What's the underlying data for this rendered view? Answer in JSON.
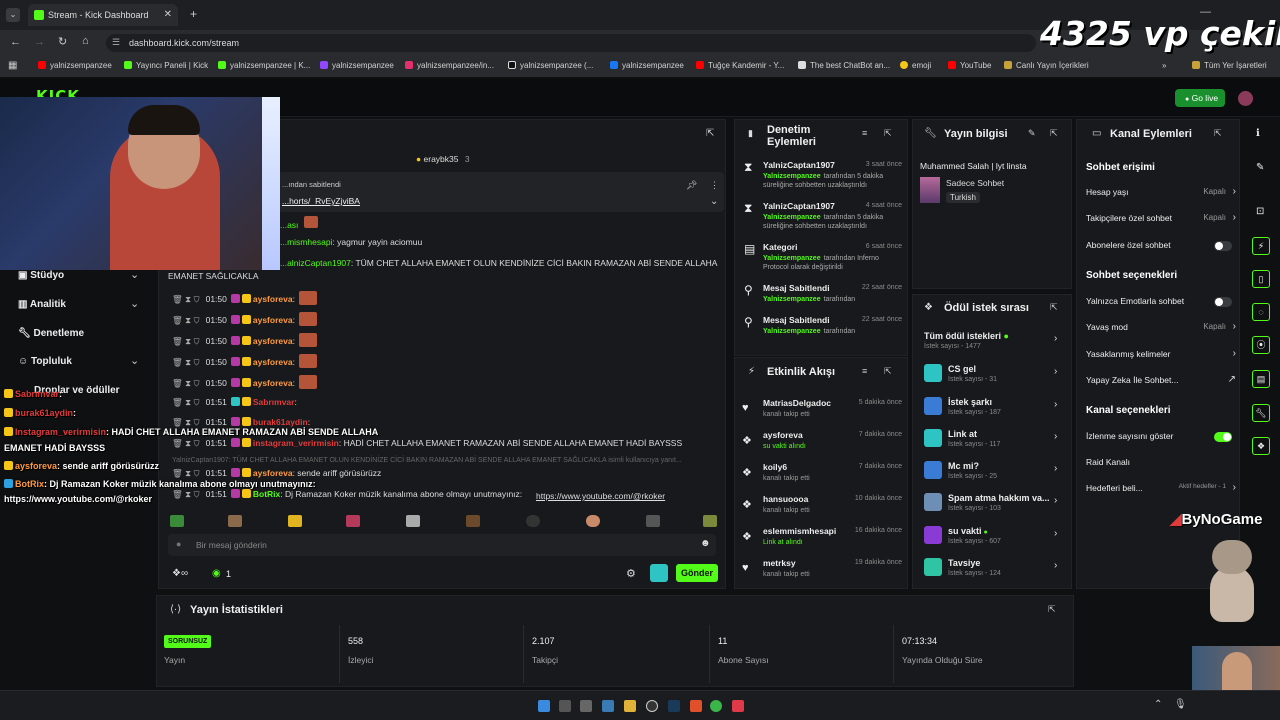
{
  "browser": {
    "tab_title": "Stream - Kick Dashboard",
    "url": "dashboard.kick.com/stream",
    "bookmarks": [
      "yalnizsempanzee",
      "Yayıncı Paneli | Kick",
      "yalnizsempanzee | K...",
      "yalnizsempanzee",
      "yalnizsempanzee/in...",
      "yalnizsempanzee (...",
      "yalnizsempanzee",
      "Tuğçe Kandemir - Y...",
      "The best ChatBot an...",
      "emoji",
      "YouTube",
      "Canlı Yayın İçerikleri",
      "Tüm Yer İşaretleri"
    ]
  },
  "overlay": {
    "giveaway_text": "4325 vp çekiliş",
    "bynogame_text": "ByNoGame",
    "chat_overlay": [
      {
        "user": "Sabrımvar",
        "text": ":",
        "color": "#e23b3b"
      },
      {
        "user": "burak61aydin",
        "text": ":",
        "color": "#e23b3b"
      },
      {
        "user": "Instagram_verirmisin",
        "text": ": HADİ CHET ALLAHA EMANET RAMAZAN ABİ SENDE ALLAHA",
        "color": "#e23b3b"
      },
      {
        "user": "",
        "text": "EMANET HADİ BAYSSS",
        "color": "#ffffff"
      },
      {
        "user": "aysforeva",
        "text": ": sende ariff görüsürüzz",
        "color": "#ff9b3d"
      },
      {
        "user": "BotRix",
        "text": ": Dj Ramazan Koker müzik kanalıma abone olmayı unutmayınız:",
        "color": "#ff9b3d"
      },
      {
        "user": "",
        "text": "https://www.youtube.com/@rkoker",
        "color": "#ffffff"
      }
    ]
  },
  "topnav": {
    "go_live_label": "Go live"
  },
  "sidebar": {
    "items": [
      "Stüdyo",
      "Analitik",
      "Denetleme",
      "Topluluk",
      "Droplar ve ödüller"
    ]
  },
  "chat": {
    "header_user": "eraybk35",
    "header_count": "3",
    "pinned_label": "...ından sabitlendi",
    "pinned_link": "...horts/_RvEyZjviBA",
    "lines": [
      {
        "user": "...ası",
        "text": ""
      },
      {
        "user": "...mismhesapi",
        "text": ": yagmur yayin aciomuu"
      },
      {
        "user": "...alnizCaptan1907",
        "text": ": TÜM CHET ALLAHA EMANET OLUN KENDİNİZE CİCİ BAKIN RAMAZAN ABİ SENDE ALLAHA"
      },
      {
        "user": "",
        "text": "EMANET SAĞLICAKLA"
      }
    ],
    "timed_lines": [
      {
        "time": "01:50",
        "user": "aysforeva",
        "text": ":"
      },
      {
        "time": "01:50",
        "user": "aysforeva",
        "text": ":"
      },
      {
        "time": "01:50",
        "user": "aysforeva",
        "text": ":"
      },
      {
        "time": "01:50",
        "user": "aysforeva",
        "text": ":"
      },
      {
        "time": "01:50",
        "user": "aysforeva",
        "text": ":"
      },
      {
        "time": "01:51",
        "user": "Sabrımvar",
        "text": ":"
      },
      {
        "time": "01:51",
        "user": "burak61aydin",
        "text": ":"
      },
      {
        "time": "01:51",
        "user": "instagram_verirmisin",
        "text": ": HADİ CHET ALLAHA EMANET RAMAZAN ABİ SENDE ALLAHA EMANET HADİ BAYSSS"
      },
      {
        "time": "01:51",
        "user": "aysforeva",
        "text": ": sende ariff görüsürüzz"
      },
      {
        "time": "01:51",
        "user": "BotRix",
        "text": ": Dj Ramazan Koker müzik kanalıma abone olmayı unutmayınız: "
      }
    ],
    "reply_line": "YalnizCaptan1907: TÜM CHET ALLAHA EMANET OLUN KENDİNİZE CİCİ BAKIN RAMAZAN ABİ SENDE ALLAHA EMANET SAĞLICAKLA isimli kullanıcıya yanıt...",
    "botrix_link": "https://www.youtube.com/@rkoker",
    "input_placeholder": "Bir mesaj gönderin",
    "points": "1",
    "send_label": "Gönder"
  },
  "moderation": {
    "title": "Denetim Eylemleri",
    "rows": [
      {
        "icon": "⧗",
        "name": "YalnizCaptan1907",
        "time": "3 saat önce",
        "who": "Yalnizsempanzee",
        "desc": "tarafından 5 dakika süreliğine sohbetten uzaklaştırıldı"
      },
      {
        "icon": "⧗",
        "name": "YalnizCaptan1907",
        "time": "4 saat önce",
        "who": "Yalnizsempanzee",
        "desc": "tarafından 5 dakika süreliğine sohbetten uzaklaştırıldı"
      },
      {
        "icon": "▤",
        "name": "Kategori",
        "time": "6 saat önce",
        "who": "Yalnizsempanzee",
        "desc": "tarafından Inferno Protocol olarak değiştirildi"
      },
      {
        "icon": "⚲",
        "name": "Mesaj Sabitlendi",
        "time": "22 saat önce",
        "who": "Yalnizsempanzee",
        "desc": "tarafından"
      },
      {
        "icon": "⚲",
        "name": "Mesaj Sabitlendi",
        "time": "22 saat önce",
        "who": "Yalnizsempanzee",
        "desc": "tarafından"
      }
    ]
  },
  "activity": {
    "title": "Etkinlik Akışı",
    "rows": [
      {
        "icon": "♥",
        "name": "MatriasDelgadoc",
        "time": "5 dakika önce",
        "desc": "kanalı takip etti"
      },
      {
        "icon": "❖",
        "name": "aysforeva",
        "time": "7 dakika önce",
        "desc": "su vakti alındı"
      },
      {
        "icon": "❖",
        "name": "koily6",
        "time": "7 dakika önce",
        "desc": "kanalı takip etti"
      },
      {
        "icon": "❖",
        "name": "hansuoooa",
        "time": "10 dakika önce",
        "desc": "kanalı takip etti"
      },
      {
        "icon": "❖",
        "name": "eslemmismhesapi",
        "time": "16 dakika önce",
        "desc": "Link at alındı"
      },
      {
        "icon": "♥",
        "name": "metrksy",
        "time": "19 dakika önce",
        "desc": "kanalı takip etti"
      }
    ]
  },
  "stream_info": {
    "title": "Yayın bilgisi",
    "stream_title": "Muhammed Salah | lyt linsta",
    "category": "Sadece Sohbet",
    "language": "Turkish"
  },
  "rewards": {
    "title": "Ödül istek sırası",
    "all_label": "Tüm ödül istekleri",
    "all_count": "İstek sayısı - 1477",
    "items": [
      {
        "name": "CS gel",
        "count": "İstek sayısı - 31",
        "color": "#2ec4c4"
      },
      {
        "name": "İstek şarkı",
        "count": "İstek sayısı - 187",
        "color": "#3a7bd5"
      },
      {
        "name": "Link at",
        "count": "İstek sayısı - 117",
        "color": "#2ec4c4"
      },
      {
        "name": "Mc mi?",
        "count": "İstek sayısı - 25",
        "color": "#3a7bd5"
      },
      {
        "name": "Spam atma hakkım va...",
        "count": "İstek sayısı - 103",
        "color": "#6e8fb5"
      },
      {
        "name": "su vakti",
        "count": "İstek sayısı - 607",
        "color": "#8a3bd5"
      },
      {
        "name": "Tavsiye",
        "count": "İstek sayısı - 124",
        "color": "#2ec4a4"
      }
    ]
  },
  "channel_actions": {
    "title": "Kanal Eylemleri",
    "chat_access_head": "Sohbet erişimi",
    "chat_access": [
      {
        "label": "Hesap yaşı",
        "value": "Kapalı"
      },
      {
        "label": "Takipçilere özel sohbet",
        "value": "Kapalı"
      },
      {
        "label": "Abonelere özel sohbet",
        "value": ""
      }
    ],
    "chat_options_head": "Sohbet seçenekleri",
    "chat_options": [
      {
        "label": "Yalnızca Emotlarla sohbet",
        "value": ""
      },
      {
        "label": "Yavaş mod",
        "value": "Kapalı"
      },
      {
        "label": "Yasaklanmış kelimeler",
        "value": ""
      },
      {
        "label": "Yapay Zeka İle Sohbet...",
        "value": ""
      }
    ],
    "channel_options_head": "Kanal seçenekleri",
    "channel_options": [
      {
        "label": "İzlenme sayısını göster",
        "value": ""
      },
      {
        "label": "Raid Kanalı",
        "value": ""
      },
      {
        "label": "Hedefleri beli...",
        "value": "Aktif hedefler - 1"
      }
    ]
  },
  "stats": {
    "title": "Yayın İstatistikleri",
    "status_badge": "SORUNSUZ",
    "items": [
      {
        "value": "",
        "label": "Yayın"
      },
      {
        "value": "558",
        "label": "İzleyici"
      },
      {
        "value": "2.107",
        "label": "Takipçi"
      },
      {
        "value": "11",
        "label": "Abone Sayısı"
      },
      {
        "value": "07:13:34",
        "label": "Yayında Olduğu Süre"
      }
    ]
  },
  "colors": {
    "accent": "#53fc18",
    "bg": "#0f1012",
    "panel": "#18191c"
  }
}
